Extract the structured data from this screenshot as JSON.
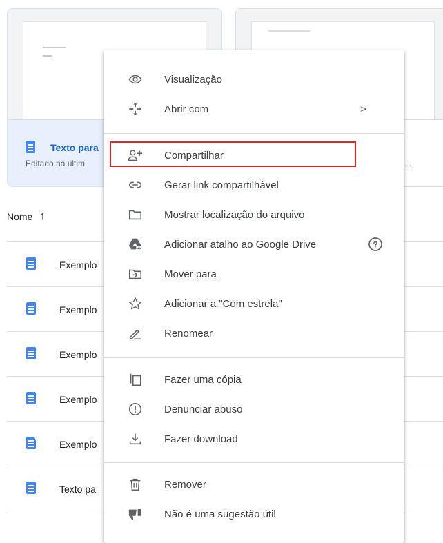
{
  "quick_access": [
    {
      "title": "Texto para",
      "subtitle": "Editado na últim"
    },
    {
      "title": "",
      "subtitle": "em..."
    }
  ],
  "list": {
    "column_header": "Nome",
    "sort_arrow": "↑",
    "files": [
      {
        "name": "Exemplo",
        "icon": "google-docs-icon"
      },
      {
        "name": "Exemplo",
        "icon": "google-docs-icon"
      },
      {
        "name": "Exemplo",
        "icon": "google-docs-icon"
      },
      {
        "name": "Exemplo",
        "icon": "google-docs-icon"
      },
      {
        "name": "Exemplo",
        "icon": "word-document-icon"
      },
      {
        "name": "Texto pa",
        "icon": "google-docs-icon"
      }
    ]
  },
  "menu": {
    "items": [
      {
        "label": "Visualização",
        "icon": "eye-icon"
      },
      {
        "label": "Abrir com",
        "icon": "move-arrows-icon",
        "chevron": ">"
      },
      {
        "label": "Compartilhar",
        "icon": "add-person-icon",
        "highlighted": true
      },
      {
        "label": "Gerar link compartilhável",
        "icon": "link-icon"
      },
      {
        "label": "Mostrar localização do arquivo",
        "icon": "folder-icon"
      },
      {
        "label": "Adicionar atalho ao Google Drive",
        "icon": "drive-shortcut-icon",
        "help": "?"
      },
      {
        "label": "Mover para",
        "icon": "move-to-folder-icon"
      },
      {
        "label": "Adicionar a \"Com estrela\"",
        "icon": "star-icon"
      },
      {
        "label": "Renomear",
        "icon": "pencil-icon"
      },
      {
        "label": "Fazer uma cópia",
        "icon": "copy-icon"
      },
      {
        "label": "Denunciar abuso",
        "icon": "alert-icon"
      },
      {
        "label": "Fazer download",
        "icon": "download-icon"
      },
      {
        "label": "Remover",
        "icon": "trash-icon"
      },
      {
        "label": "Não é uma sugestão útil",
        "icon": "thumb-down-icon"
      }
    ]
  },
  "colors": {
    "highlight_border": "#e2241b",
    "docs_blue": "#4285f4",
    "selected_card": "#e8f0fe"
  }
}
